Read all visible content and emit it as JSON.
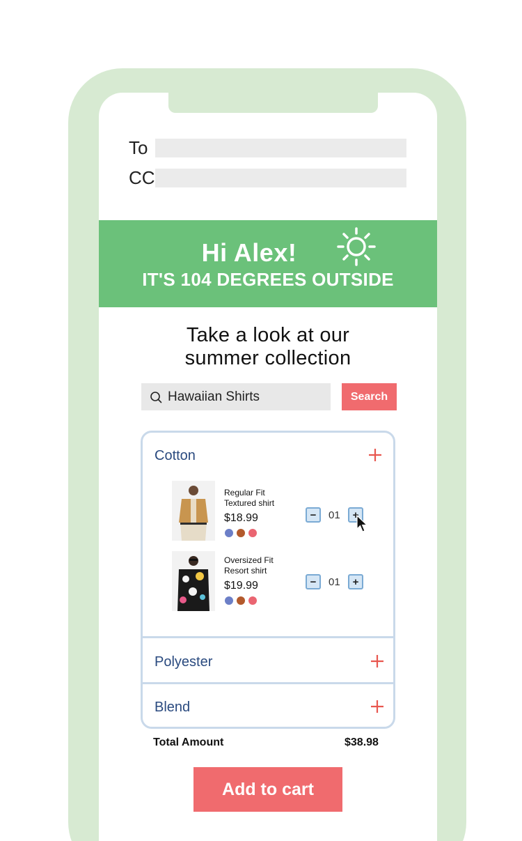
{
  "email": {
    "to_label": "To",
    "cc_label": "CC"
  },
  "banner": {
    "greeting": "Hi Alex!",
    "temperature": "IT'S 104 DEGREES OUTSIDE",
    "icon": "sun-icon",
    "color": "#6bc17a"
  },
  "heading": {
    "line1": "Take a look at our",
    "line2": "summer collection"
  },
  "search": {
    "value": "Hawaiian Shirts",
    "button_label": "Search",
    "icon": "search-icon"
  },
  "categories": [
    {
      "label": "Cotton",
      "expanded": true,
      "products": [
        {
          "name_line1": "Regular Fit",
          "name_line2": "Textured shirt",
          "price": "$18.99",
          "quantity": "01",
          "colors": [
            "#6c7fc7",
            "#b35a2c",
            "#ea6571"
          ]
        },
        {
          "name_line1": "Oversized Fit",
          "name_line2": "Resort shirt",
          "price": "$19.99",
          "quantity": "01",
          "colors": [
            "#6c7fc7",
            "#b35a2c",
            "#ea6571"
          ]
        }
      ]
    },
    {
      "label": "Polyester",
      "expanded": false
    },
    {
      "label": "Blend",
      "expanded": false
    }
  ],
  "total": {
    "label": "Total Amount",
    "value": "$38.98"
  },
  "cart_button_label": "Add to cart",
  "colors": {
    "accent": "#f06b6e",
    "frame": "#d7ead2",
    "accordion_border": "#c9d9ea"
  }
}
